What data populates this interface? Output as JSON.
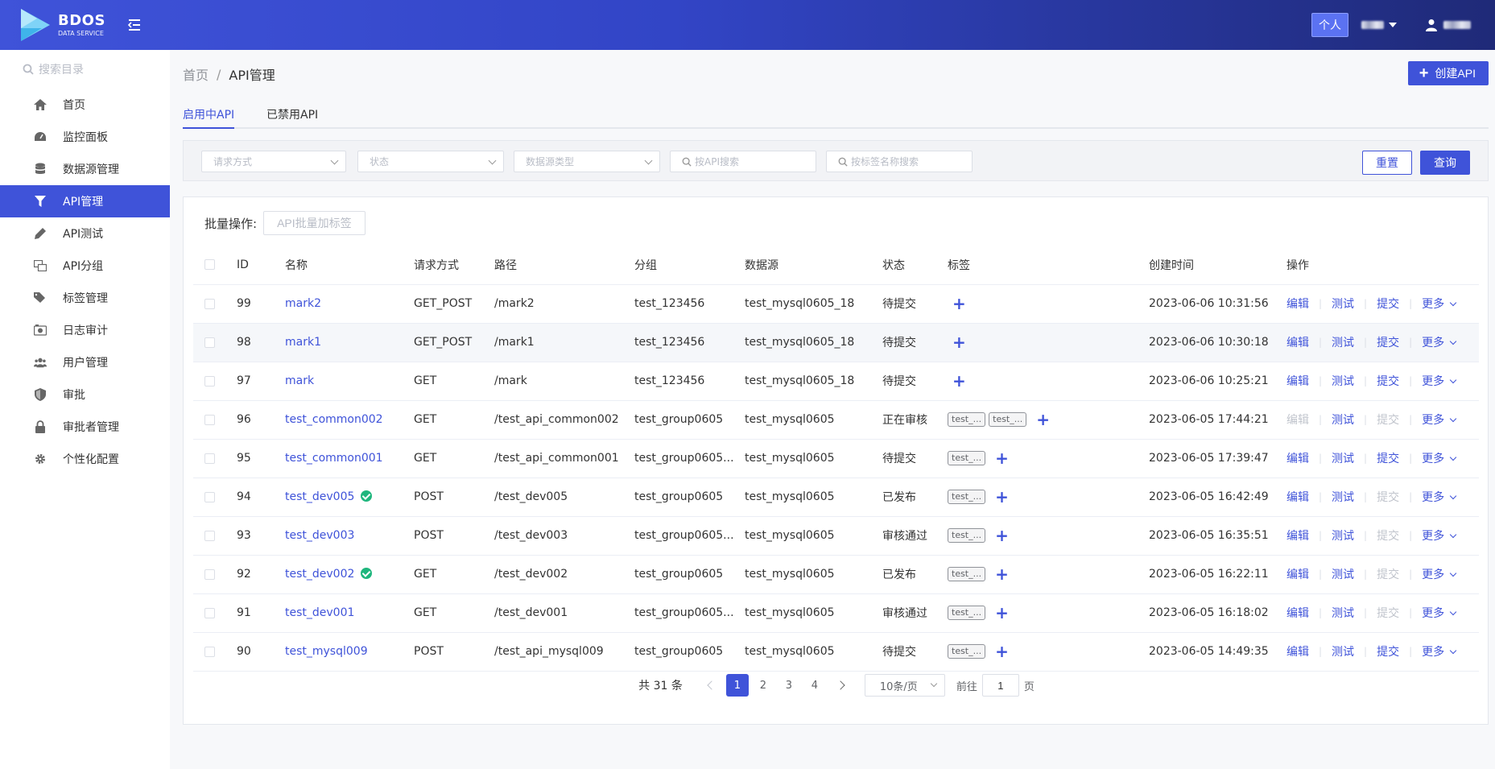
{
  "header": {
    "logo_title": "BDOS",
    "logo_subtitle": "DATA SERVICE",
    "personal_badge": "个人"
  },
  "sidebar": {
    "search_placeholder": "搜索目录",
    "items": [
      {
        "label": "首页",
        "icon": "home-icon"
      },
      {
        "label": "监控面板",
        "icon": "dashboard-icon"
      },
      {
        "label": "数据源管理",
        "icon": "database-icon"
      },
      {
        "label": "API管理",
        "icon": "filter-icon",
        "active": true
      },
      {
        "label": "API测试",
        "icon": "pen-icon"
      },
      {
        "label": "API分组",
        "icon": "group-icon"
      },
      {
        "label": "标签管理",
        "icon": "tags-icon"
      },
      {
        "label": "日志审计",
        "icon": "log-icon"
      },
      {
        "label": "用户管理",
        "icon": "users-icon"
      },
      {
        "label": "审批",
        "icon": "shield-icon"
      },
      {
        "label": "审批者管理",
        "icon": "lock-icon"
      },
      {
        "label": "个性化配置",
        "icon": "gear-icon"
      }
    ]
  },
  "breadcrumb": {
    "home": "首页",
    "separator": "/",
    "current": "API管理"
  },
  "create_button": "创建API",
  "tabs": [
    {
      "label": "启用中API",
      "active": true
    },
    {
      "label": "已禁用API",
      "active": false
    }
  ],
  "filters": {
    "method_placeholder": "请求方式",
    "status_placeholder": "状态",
    "datasource_type_placeholder": "数据源类型",
    "api_search_placeholder": "按API搜索",
    "tag_search_placeholder": "按标签名称搜索",
    "reset": "重置",
    "query": "查询"
  },
  "batch": {
    "label": "批量操作:",
    "button": "API批量加标签"
  },
  "table": {
    "columns": [
      "ID",
      "名称",
      "请求方式",
      "路径",
      "分组",
      "数据源",
      "状态",
      "标签",
      "创建时间",
      "操作"
    ],
    "ops": {
      "edit": "编辑",
      "test": "测试",
      "submit": "提交",
      "more": "更多",
      "sep": "|"
    },
    "rows": [
      {
        "id": "99",
        "name": "mark2",
        "verified": false,
        "method": "GET_POST",
        "path": "/mark2",
        "group": "test_123456",
        "source": "test_mysql0605_18",
        "status": "待提交",
        "tags": [],
        "created": "2023-06-06 10:31:56",
        "edit_enabled": true,
        "submit_enabled": true
      },
      {
        "id": "98",
        "name": "mark1",
        "verified": false,
        "method": "GET_POST",
        "path": "/mark1",
        "group": "test_123456",
        "source": "test_mysql0605_18",
        "status": "待提交",
        "tags": [],
        "created": "2023-06-06 10:30:18",
        "edit_enabled": true,
        "submit_enabled": true
      },
      {
        "id": "97",
        "name": "mark",
        "verified": false,
        "method": "GET",
        "path": "/mark",
        "group": "test_123456",
        "source": "test_mysql0605_18",
        "status": "待提交",
        "tags": [],
        "created": "2023-06-06 10:25:21",
        "edit_enabled": true,
        "submit_enabled": true
      },
      {
        "id": "96",
        "name": "test_common002",
        "verified": false,
        "method": "GET",
        "path": "/test_api_common002",
        "group": "test_group0605",
        "source": "test_mysql0605",
        "status": "正在审核",
        "tags": [
          "test_...",
          "test_..."
        ],
        "created": "2023-06-05 17:44:21",
        "edit_enabled": false,
        "submit_enabled": false
      },
      {
        "id": "95",
        "name": "test_common001",
        "verified": false,
        "method": "GET",
        "path": "/test_api_common001",
        "group": "test_group0605...",
        "source": "test_mysql0605",
        "status": "待提交",
        "tags": [
          "test_..."
        ],
        "created": "2023-06-05 17:39:47",
        "edit_enabled": true,
        "submit_enabled": true
      },
      {
        "id": "94",
        "name": "test_dev005",
        "verified": true,
        "method": "POST",
        "path": "/test_dev005",
        "group": "test_group0605",
        "source": "test_mysql0605",
        "status": "已发布",
        "tags": [
          "test_..."
        ],
        "created": "2023-06-05 16:42:49",
        "edit_enabled": true,
        "submit_enabled": false
      },
      {
        "id": "93",
        "name": "test_dev003",
        "verified": false,
        "method": "POST",
        "path": "/test_dev003",
        "group": "test_group0605...",
        "source": "test_mysql0605",
        "status": "审核通过",
        "tags": [
          "test_..."
        ],
        "created": "2023-06-05 16:35:51",
        "edit_enabled": true,
        "submit_enabled": false
      },
      {
        "id": "92",
        "name": "test_dev002",
        "verified": true,
        "method": "GET",
        "path": "/test_dev002",
        "group": "test_group0605",
        "source": "test_mysql0605",
        "status": "已发布",
        "tags": [
          "test_..."
        ],
        "created": "2023-06-05 16:22:11",
        "edit_enabled": true,
        "submit_enabled": false
      },
      {
        "id": "91",
        "name": "test_dev001",
        "verified": false,
        "method": "GET",
        "path": "/test_dev001",
        "group": "test_group0605...",
        "source": "test_mysql0605",
        "status": "审核通过",
        "tags": [
          "test_..."
        ],
        "created": "2023-06-05 16:18:02",
        "edit_enabled": true,
        "submit_enabled": false
      },
      {
        "id": "90",
        "name": "test_mysql009",
        "verified": false,
        "method": "POST",
        "path": "/test_api_mysql009",
        "group": "test_group0605",
        "source": "test_mysql0605",
        "status": "待提交",
        "tags": [
          "test_..."
        ],
        "created": "2023-06-05 14:49:35",
        "edit_enabled": true,
        "submit_enabled": true
      }
    ],
    "highlighted_row": 1
  },
  "pagination": {
    "total": "共 31 条",
    "pages": [
      "1",
      "2",
      "3",
      "4"
    ],
    "current": "1",
    "page_size": "10条/页",
    "goto_label": "前往",
    "goto_value": "1",
    "goto_suffix": "页"
  },
  "colors": {
    "primary": "#3f53d9",
    "success": "#1fb67d",
    "header_gradient_end": "#1f2a78"
  }
}
